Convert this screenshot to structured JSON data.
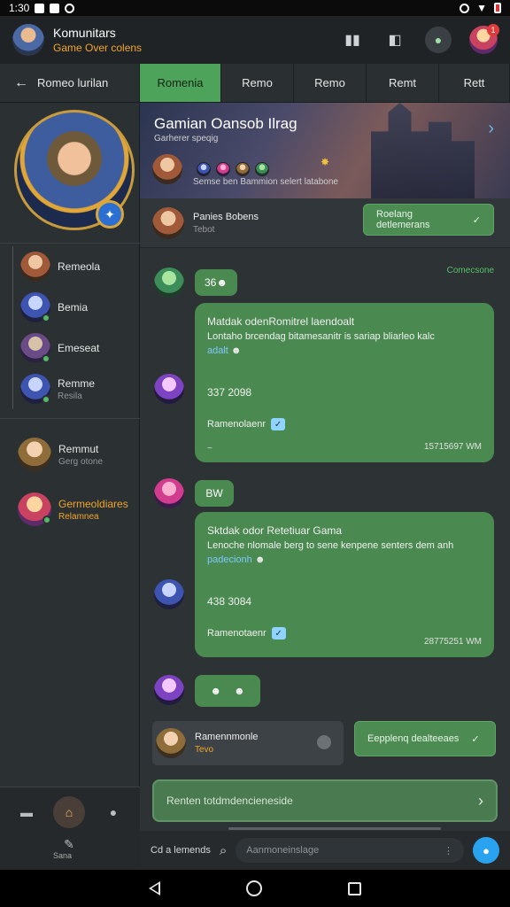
{
  "status_bar": {
    "time": "1:30"
  },
  "header": {
    "title": "Komunitars",
    "subtitle": "Game Over colens",
    "notification_count": "1"
  },
  "tabs": {
    "back_label": "Romeo lurilan",
    "items": [
      "Romenia",
      "Remo",
      "Remo",
      "Remt",
      "Rett"
    ],
    "active_index": 0
  },
  "sidebar": {
    "members": [
      {
        "name": "Remeola",
        "sub": "",
        "online": false
      },
      {
        "name": "Bemia",
        "sub": "",
        "online": true
      },
      {
        "name": "Emeseat",
        "sub": "",
        "online": true
      },
      {
        "name": "Remme",
        "sub": "Resila",
        "online": true
      }
    ],
    "recent": [
      {
        "name": "Remmut",
        "sub": "Gerg otone",
        "highlight": false
      },
      {
        "name": "Germeoldiares",
        "sub": "Relamnea",
        "highlight": true
      }
    ],
    "bottom_label": "Sana"
  },
  "banner": {
    "title": "Gamian Oansob Ilrag",
    "subtitle": "Garherer speqig",
    "stats": "Semse ben Bammion selert latabone"
  },
  "pinned": {
    "name": "Panies Bobens",
    "sub": "Tebot",
    "button_label": "Roelang detlemerans"
  },
  "chat": {
    "time_label": "Comecsone",
    "messages": [
      {
        "pill": "36",
        "line1": "Matdak odenRomitrel laendoalt",
        "line2": "Lontaho brcendag bitamesanitr is sariap bliarleo kalc",
        "link": "adalt",
        "number": "337 2098",
        "verified_label": "Ramenolaenr",
        "meta": "15715697 WM",
        "footer": "~"
      },
      {
        "pill": "BW",
        "line1": "Sktdak odor Retetiuar Gama",
        "line2": "Lenoche nlomale berg to sene kenpene senters dem anh",
        "link": "padecionh",
        "number": "438 3084",
        "verified_label": "Ramenotaenr",
        "meta": "28775251 WM",
        "footer": ""
      }
    ],
    "reaction_pill": "",
    "reply": {
      "name": "Ramennmonle",
      "sub": "Tevo",
      "button_label": "Eepplenq dealteeaes"
    }
  },
  "input": {
    "placeholder": "Renten totdmdencieneside"
  },
  "search_row": {
    "left_label": "Cd a lemends",
    "placeholder": "Aanmoneinslage"
  },
  "colors": {
    "accent_green": "#4ea35a",
    "bubble_green": "#4a8a50",
    "gold": "#f0a52a",
    "link_blue": "#7fc8ff"
  }
}
